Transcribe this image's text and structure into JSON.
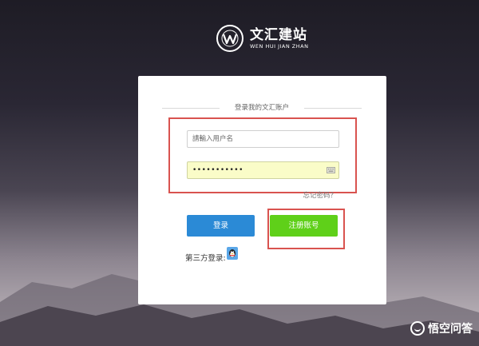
{
  "brand": {
    "name_cn": "文汇建站",
    "name_en": "WEN HUI JIAN ZHAN",
    "logo_icon": "globe-w-icon"
  },
  "login_card": {
    "heading": "登录我的文汇账户",
    "username": {
      "placeholder": "請輸入用户名",
      "value": ""
    },
    "password": {
      "masked_value": "•••••••••••",
      "icon": "keyboard-icon"
    },
    "forgot_link": "忘记密码？",
    "login_button": "登录",
    "register_button": "注册账号",
    "third_party_label": "第三方登录:",
    "qq_icon": "qq-penguin-icon"
  },
  "watermark": {
    "text": "悟空问答"
  },
  "colors": {
    "login_button": "#2b8ad6",
    "register_button": "#5fd019",
    "highlight_box": "#d9534f",
    "password_autofill": "#fafcc8"
  }
}
